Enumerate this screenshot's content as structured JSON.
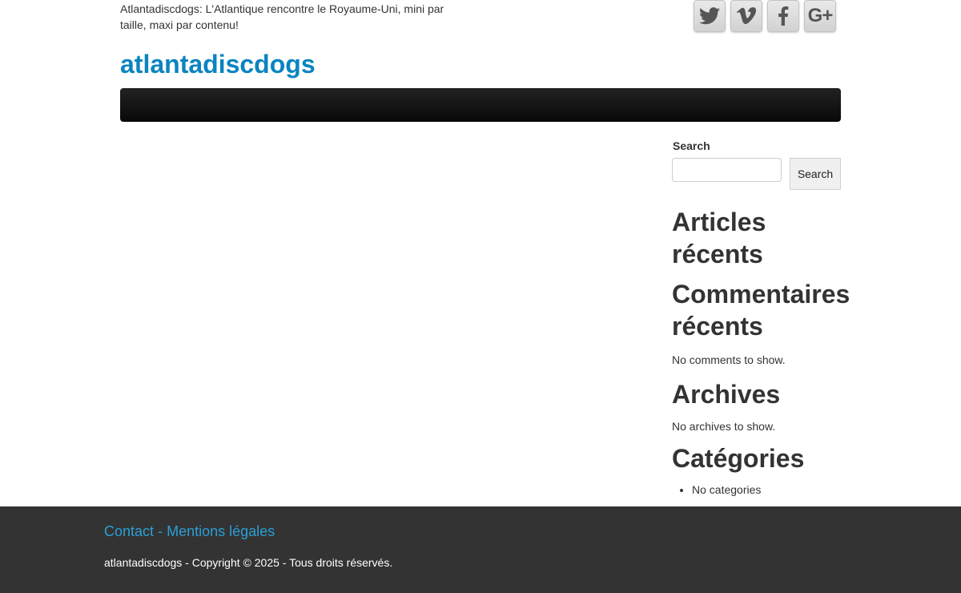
{
  "header": {
    "tagline": "Atlantadiscdogs: L'Atlantique rencontre le Royaume-Uni, mini par taille, maxi par contenu!",
    "site_title": "atlantadiscdogs",
    "social": [
      {
        "icon": "twitter-icon"
      },
      {
        "icon": "vimeo-icon"
      },
      {
        "icon": "facebook-icon"
      },
      {
        "icon": "google-plus-icon",
        "glyph": "G+"
      }
    ]
  },
  "sidebar": {
    "search": {
      "label": "Search",
      "value": "",
      "placeholder": "",
      "button_label": "Search"
    },
    "recent_posts": {
      "title": "Articles récents"
    },
    "recent_comments": {
      "title": "Commentaires récents",
      "empty_text": "No comments to show."
    },
    "archives": {
      "title": "Archives",
      "empty_text": "No archives to show."
    },
    "categories": {
      "title": "Catégories",
      "items": [
        "No categories"
      ]
    }
  },
  "footer": {
    "links": {
      "contact": "Contact",
      "separator": "-",
      "legal": "Mentions légales"
    },
    "copyright": "atlantadiscdogs - Copyright © 2025 - Tous droits réservés."
  },
  "colors": {
    "link_blue": "#0a84c1",
    "navbar": "#111111",
    "footer_bg": "#333333",
    "footer_link": "#2a9fd6"
  }
}
